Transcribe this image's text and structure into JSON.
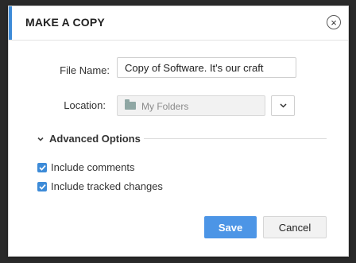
{
  "dialog": {
    "title": "MAKE A COPY",
    "close_glyph": "×"
  },
  "form": {
    "file_name_label": "File Name:",
    "file_name_value": "Copy of Software. It's our craft",
    "location_label": "Location:",
    "location_value": "My Folders",
    "location_icon": "folder-icon",
    "location_dropdown_icon": "chevron-down-icon"
  },
  "advanced": {
    "label": "Advanced Options",
    "expanded": true,
    "options": [
      {
        "label": "Include comments",
        "checked": true
      },
      {
        "label": "Include tracked changes",
        "checked": true
      }
    ]
  },
  "buttons": {
    "save_label": "Save",
    "cancel_label": "Cancel"
  },
  "colors": {
    "accent": "#3d8bd8",
    "save_button": "#4c95e6",
    "checkbox": "#3d8bd8",
    "folder_icon": "#8fa7a4"
  }
}
